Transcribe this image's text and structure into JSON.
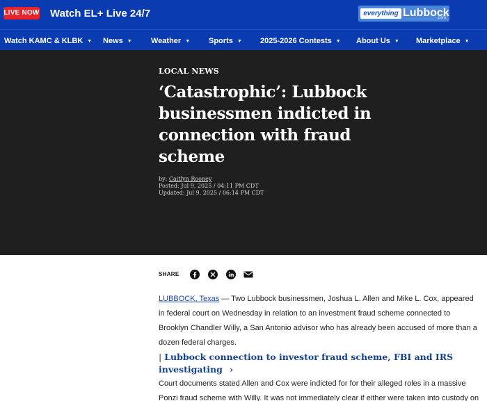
{
  "topbar": {
    "live_badge": "LIVE NOW",
    "watch_live": "Watch EL+ Live 24/7",
    "logo_left": "everything",
    "logo_right": "Lubbock",
    "logo_sub": ".com"
  },
  "nav": {
    "items": [
      {
        "label": "Watch KAMC & KLBK"
      },
      {
        "label": "News"
      },
      {
        "label": "Weather"
      },
      {
        "label": "Sports"
      },
      {
        "label": "2025-2026 Contests"
      },
      {
        "label": "About Us"
      },
      {
        "label": "Marketplace"
      }
    ],
    "caret": "▼"
  },
  "article": {
    "kicker": "LOCAL NEWS",
    "headline": "‘Catastrophic’: Lubbock businessmen indicted in connection with fraud scheme",
    "by_prefix": "by: ",
    "author": "Caitlyn Rooney",
    "posted": "Posted: Jul 9, 2025 / 04:11 PM CDT",
    "updated": "Updated: Jul 9, 2025 / 06:14 PM CDT",
    "share_label": "SHARE",
    "dateline": "LUBBOCK, Texas",
    "para1_rest": " — Two Lubbock businessmen, Joshua L. Allen and Mike L. Cox, appeared in federal court on Wednesday in relation to an investment fraud scheme connected to Brooklyn Chandler Willy, a San Antonio advisor who has already been accused of more than a dozen federal charges.",
    "related_bar": "|",
    "related_link": "Lubbock connection to investor fraud scheme, FBI and IRS investigating",
    "related_chevron": "›",
    "para2": "Court documents stated Allen and Cox were indicted for for their alleged roles in a massive Ponzi fraud scheme with Willy. It was not immediately clear if either were taken into custody on"
  },
  "icons": {
    "share": [
      "facebook-icon",
      "x-icon",
      "linkedin-icon",
      "email-icon"
    ]
  },
  "colors": {
    "brand_blue": "#0a3bb0",
    "live_red": "#e8232a",
    "hero_bg": "#1f1f1f",
    "link_blue": "#13408f"
  }
}
